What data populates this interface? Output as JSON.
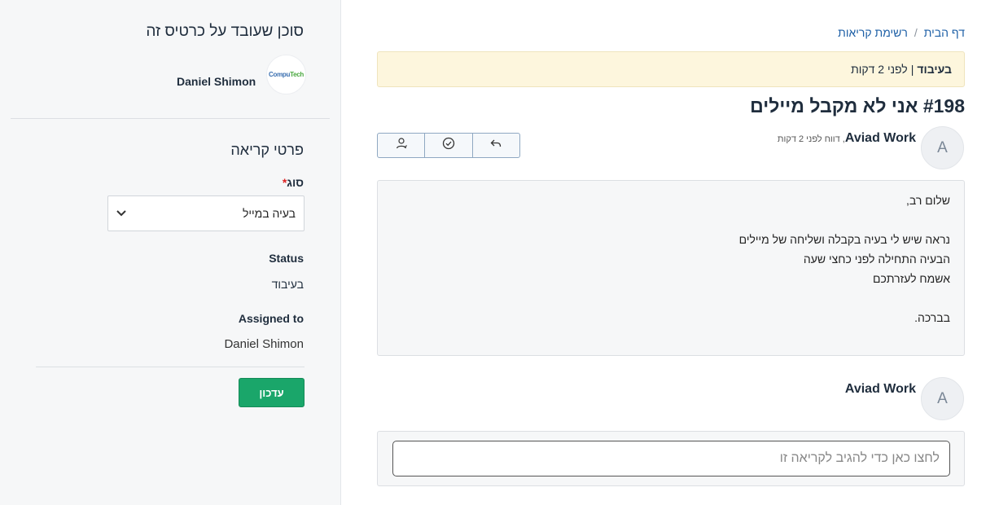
{
  "sidebar": {
    "agent_title": "סוכן שעובד על כרטיס זה",
    "agent_logo_text_1": "Compu",
    "agent_logo_text_2": "Tech",
    "agent_name": "Daniel Shimon",
    "section_title": "פרטי קריאה",
    "type_label": "סוג",
    "type_required_mark": "*",
    "type_value": "בעיה במייל",
    "status_label": "Status",
    "status_value": "בעיבוד",
    "assigned_label": "Assigned to",
    "assigned_value": "Daniel Shimon",
    "update_button": "עדכון"
  },
  "breadcrumb": {
    "home": "דף הבית",
    "separator": "/",
    "list": "רשימת קריאות"
  },
  "banner": {
    "status": "בעיבוד",
    "separator": "|",
    "time": "לפני 2 דקות"
  },
  "ticket": {
    "title": "#198 אני לא מקבל מיילים"
  },
  "message": {
    "avatar_letter": "A",
    "author": "Aviad Work",
    "meta": ", דווח לפני 2 דקות",
    "lines": [
      "שלום רב,",
      "",
      "נראה שיש לי בעיה בקבלה ושליחה של מיילים",
      "הבעיה התחילה לפני כחצי שעה",
      "אשמח לעזרתכם",
      "",
      "בברכה."
    ]
  },
  "reply": {
    "avatar_letter": "A",
    "author": "Aviad Work",
    "placeholder": "לחצו כאן כדי להגיב לקריאה זו"
  },
  "icons": {
    "assign": "user-assign-icon",
    "resolve": "check-circle-icon",
    "reply": "reply-arrow-icon"
  },
  "colors": {
    "primary_link": "#1d5fa6",
    "update_button": "#1aa66a",
    "banner_bg": "#fdf6dd"
  }
}
